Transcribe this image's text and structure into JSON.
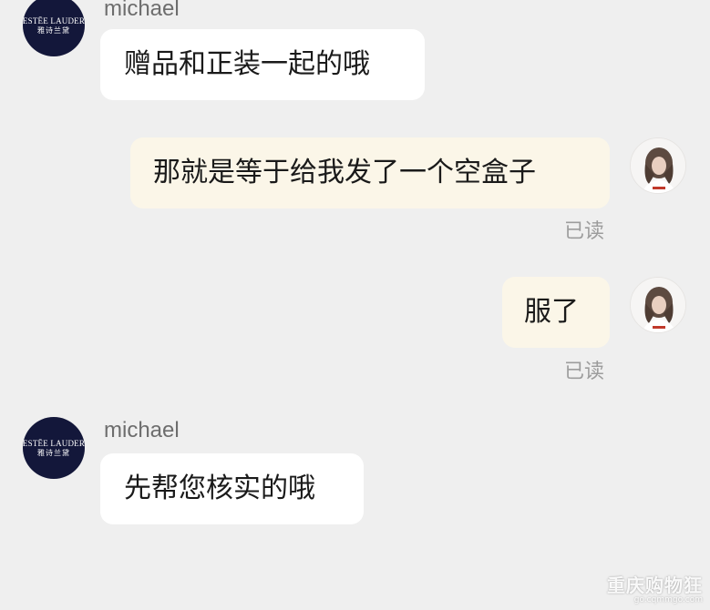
{
  "brand_avatar": {
    "name_en": "ESTĒE LAUDER",
    "name_cn": "雅诗兰黛"
  },
  "messages": [
    {
      "sender": "michael",
      "text": "赠品和正装一起的哦"
    },
    {
      "text": "那就是等于给我发了一个空盒子",
      "status": "已读"
    },
    {
      "text": "服了",
      "status": "已读"
    },
    {
      "sender": "michael",
      "text": "先帮您核实的哦"
    }
  ],
  "watermark": {
    "title": "重庆购物狂",
    "url": "go.cqmmgo.com"
  }
}
